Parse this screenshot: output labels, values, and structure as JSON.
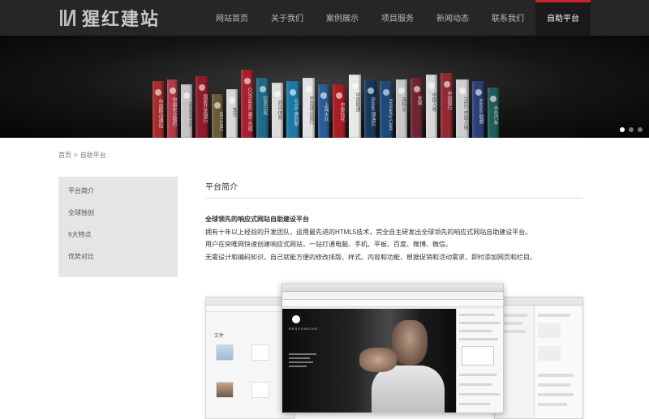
{
  "header": {
    "logo_text": "猩红建站",
    "nav": [
      {
        "label": "网站首页",
        "active": false
      },
      {
        "label": "关于我们",
        "active": false
      },
      {
        "label": "案例展示",
        "active": false
      },
      {
        "label": "项目服务",
        "active": false
      },
      {
        "label": "新闻动态",
        "active": false
      },
      {
        "label": "联系我们",
        "active": false
      },
      {
        "label": "自助平台",
        "active": true
      }
    ]
  },
  "banner": {
    "books": [
      {
        "color": "#a62b2b",
        "text": "中国移动通信"
      },
      {
        "color": "#b03a48",
        "text": "中国农业银行"
      },
      {
        "color": "#c4c4c4",
        "text": "NOVARTIS"
      },
      {
        "color": "#8e1c2a",
        "text": "国家开发银行"
      },
      {
        "color": "#6b5a3a",
        "text": "MITENO"
      },
      {
        "color": "#d8d8d8",
        "text": "宝洁"
      },
      {
        "color": "#a91f2f",
        "text": "CORNING 康宁光缆"
      },
      {
        "color": "#1e6a87",
        "text": "拉芳日化"
      },
      {
        "color": "#dcdcdc",
        "text": "乔丹体育"
      },
      {
        "color": "#1b79a8",
        "text": "OTIS 奥的斯"
      },
      {
        "color": "#e2e2e2",
        "text": "中国建设银行"
      },
      {
        "color": "#2a5d96",
        "text": "上海大众"
      },
      {
        "color": "#a81c24",
        "text": "中泰信托"
      },
      {
        "color": "#e8e8e8",
        "text": "中国联通"
      },
      {
        "color": "#17385c",
        "text": "Boloni 博洛尼"
      },
      {
        "color": "#1c4a7a",
        "text": "Kimberly-Clark"
      },
      {
        "color": "#c8c8c8",
        "text": "英特尔"
      },
      {
        "color": "#6e2434",
        "text": "宝钢"
      },
      {
        "color": "#d8d8d8",
        "text": "中国人寿"
      },
      {
        "color": "#932833",
        "text": "中国银行"
      },
      {
        "color": "#cfcfcf",
        "text": "PICC 中国人保"
      },
      {
        "color": "#2b3f7a",
        "text": "lenovo 联想"
      },
      {
        "color": "#1f5d5a",
        "text": "大众汽车"
      }
    ],
    "slides": [
      true,
      false,
      false
    ]
  },
  "breadcrumb": {
    "home": "首页",
    "separator": ">",
    "current": "自助平台"
  },
  "sidebar": {
    "items": [
      {
        "label": "平台简介"
      },
      {
        "label": "全球独创"
      },
      {
        "label": "9大特点"
      },
      {
        "label": "优势对比"
      }
    ]
  },
  "main": {
    "title": "平台简介",
    "headline": "全球领先的响应式网站自助建设平台",
    "paragraphs": [
      "拥有十年以上经验的开发团队，运用最先进的HTML5技术，完全自主研发出全球领先的响应式网站自助建设平台。",
      "用户在突唯网快速创建响应式网站，一站打通电脑、手机、平板、百度、微博、微信。",
      "无需设计和编码知识，自己就能方便的修改排版、样式、内容和功能，根据促销和活动需求，即时添加网页和栏目。"
    ]
  },
  "collage": {
    "left_window_title": "文件",
    "center_brand": "RESPONSIVE"
  }
}
